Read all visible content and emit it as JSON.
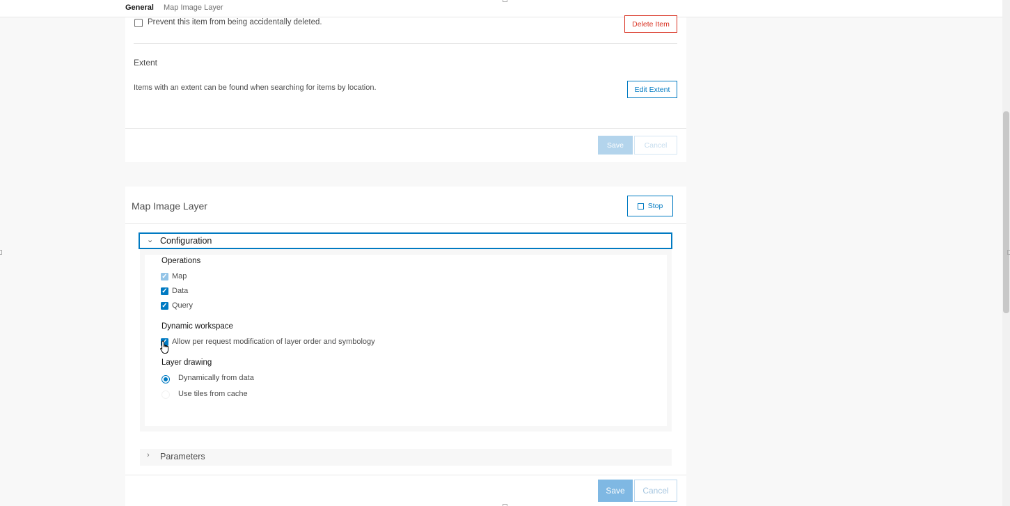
{
  "top_tabs": [
    {
      "label": "General",
      "active": true
    },
    {
      "label": "Map Image Layer",
      "active": false
    }
  ],
  "general_panel": {
    "delete_protection_label": "Prevent this item from being accidentally deleted.",
    "delete_protection_checked": false,
    "delete_button": "Delete Item",
    "extent_heading": "Extent",
    "extent_description": "Items with an extent can be found when searching for items by location.",
    "edit_extent_button": "Edit Extent",
    "save_button": "Save",
    "cancel_button": "Cancel"
  },
  "map_image_layer_panel": {
    "title": "Map Image Layer",
    "stop_button": "Stop",
    "configuration": {
      "label": "Configuration",
      "expanded": true,
      "operations_heading": "Operations",
      "operations": [
        {
          "label": "Map",
          "checked": true,
          "disabled": true
        },
        {
          "label": "Data",
          "checked": true,
          "disabled": false
        },
        {
          "label": "Query",
          "checked": true,
          "disabled": false
        }
      ],
      "dynamic_workspace_heading": "Dynamic workspace",
      "dynamic_workspace_option": {
        "label": "Allow per request modification of layer order and symbology",
        "checked": true
      },
      "layer_drawing_heading": "Layer drawing",
      "layer_drawing_options": [
        {
          "label": "Dynamically from data",
          "selected": true
        },
        {
          "label": "Use tiles from cache",
          "selected": false
        }
      ]
    },
    "parameters": {
      "label": "Parameters",
      "expanded": false
    },
    "save_button": "Save",
    "cancel_button": "Cancel"
  },
  "colors": {
    "accent": "#007ac2",
    "danger": "#d83020",
    "page_background": "#f8f8f8"
  },
  "icons": {
    "chevron_expanded": "chevron-down-icon",
    "chevron_collapsed": "chevron-right-icon",
    "stop": "square-icon",
    "cursor": "hand-pointer-icon"
  }
}
